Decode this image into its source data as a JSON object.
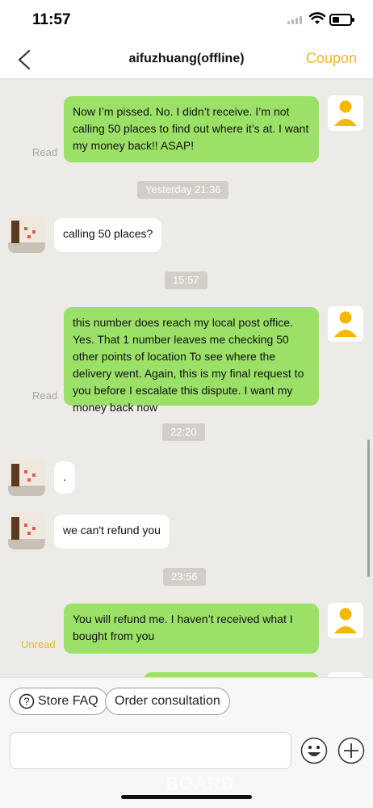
{
  "status_bar": {
    "time": "11:57",
    "battery_level": 0.3
  },
  "nav": {
    "back_icon": "chevron-left-icon",
    "title": "aifuzhuang(offline)",
    "coupon_label": "Coupon",
    "accent_color": "#f0b429"
  },
  "messages": [
    {
      "side": "out",
      "text": "Now I’m pissed. No. I didn’t receive. I’m not calling 50 places to find out where it’s at. I want my money back!! ASAP!",
      "status": "Read"
    },
    {
      "type": "time",
      "text": "Yesterday 21:36"
    },
    {
      "side": "in",
      "text": "calling 50 places?"
    },
    {
      "type": "time",
      "text": "15:57"
    },
    {
      "side": "out",
      "text": "this number does reach my local post office. Yes. That 1 number leaves me checking 50 other points of location To see where the delivery went. Again, this is my final request to you before I escalate this dispute. I want my money back now",
      "status": "Read"
    },
    {
      "type": "time",
      "text": "22:20"
    },
    {
      "side": "in",
      "text": "."
    },
    {
      "side": "in",
      "text": "we can't refund you"
    },
    {
      "type": "time",
      "text": "23:56"
    },
    {
      "side": "out",
      "text": "You will refund me. I haven’t received what I bought from you",
      "status": "Unread"
    }
  ],
  "quick_actions": [
    {
      "label": "Store FAQ",
      "icon": "question-circle-icon"
    },
    {
      "label": "Order consultation"
    }
  ],
  "input": {
    "placeholder": "",
    "emoji_icon": "emoji-icon",
    "plus_icon": "plus-circle-icon"
  },
  "watermark": "BOARD",
  "colors": {
    "outgoing_bubble": "#9be168",
    "incoming_bubble": "#ffffff",
    "chat_background": "#ecebe7",
    "read": "#a6a6a6",
    "unread": "#f0b429"
  }
}
